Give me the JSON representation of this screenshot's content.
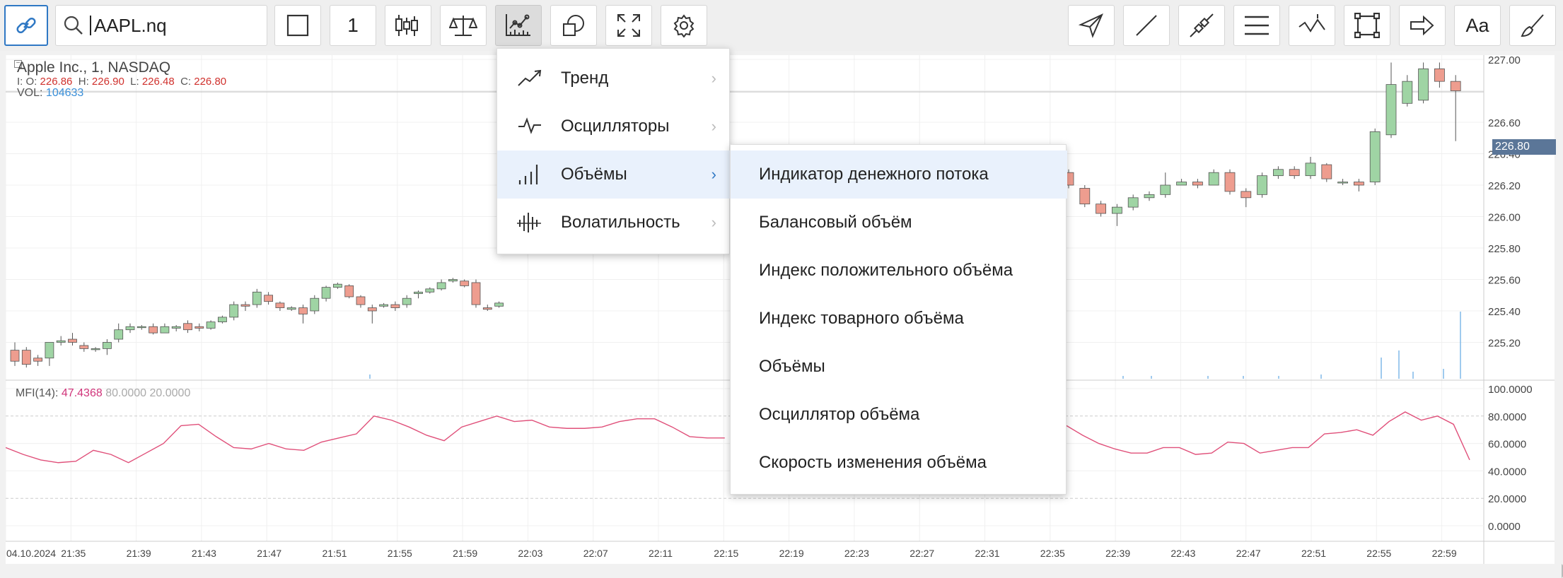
{
  "toolbar": {
    "symbol_value": "AAPL.nq",
    "interval_label": "1",
    "text_tool_label": "Aa"
  },
  "chart": {
    "title": "Apple Inc.,  1,  NASDAQ",
    "ohlc_prefix": "I: O:",
    "open": "226.86",
    "high_label": "H:",
    "high": "226.90",
    "low_label": "L:",
    "low": "226.48",
    "close_label": "C:",
    "close": "226.80",
    "volume_label": "VOL:",
    "volume": "104633",
    "current_price": "226.80",
    "price_axis": [
      "227.00",
      "226.80",
      "226.60",
      "226.40",
      "226.20",
      "226.00",
      "225.80",
      "225.60",
      "225.40",
      "225.20"
    ],
    "mfi_label": "MFI(14):",
    "mfi_value": "47.4368",
    "mfi_upper": "80.0000",
    "mfi_lower": "20.0000",
    "mfi_axis": [
      "100.0000",
      "80.0000",
      "60.0000",
      "40.0000",
      "20.0000",
      "0.0000"
    ],
    "time_axis": [
      "04.10.2024",
      "21:35",
      "21:39",
      "21:43",
      "21:47",
      "21:51",
      "21:55",
      "21:59",
      "22:03",
      "22:07",
      "22:11",
      "22:15",
      "22:19",
      "22:23",
      "22:27",
      "22:31",
      "22:35",
      "22:39",
      "22:43",
      "22:47",
      "22:51",
      "22:55",
      "22:59"
    ],
    "colors": {
      "up": "#9fd4a4",
      "down": "#ee9d8f",
      "mfi_line": "#e0507a",
      "volume": "#7fb8e8",
      "price_tag": "#5b7698"
    }
  },
  "indicator_menu": {
    "items": [
      {
        "label": "Тренд",
        "icon": "trend-icon"
      },
      {
        "label": "Осцилляторы",
        "icon": "oscillator-icon"
      },
      {
        "label": "Объёмы",
        "icon": "volume-bars-icon"
      },
      {
        "label": "Волатильность",
        "icon": "volatility-icon"
      }
    ],
    "selected": "Объёмы"
  },
  "volume_submenu": {
    "items": [
      "Индикатор денежного потока",
      "Балансовый объём",
      "Индекс положительного объёма",
      "Индекс товарного объёма",
      "Объёмы",
      "Осциллятор объёма",
      "Скорость изменения объёма"
    ],
    "highlighted": "Индикатор денежного потока"
  }
}
